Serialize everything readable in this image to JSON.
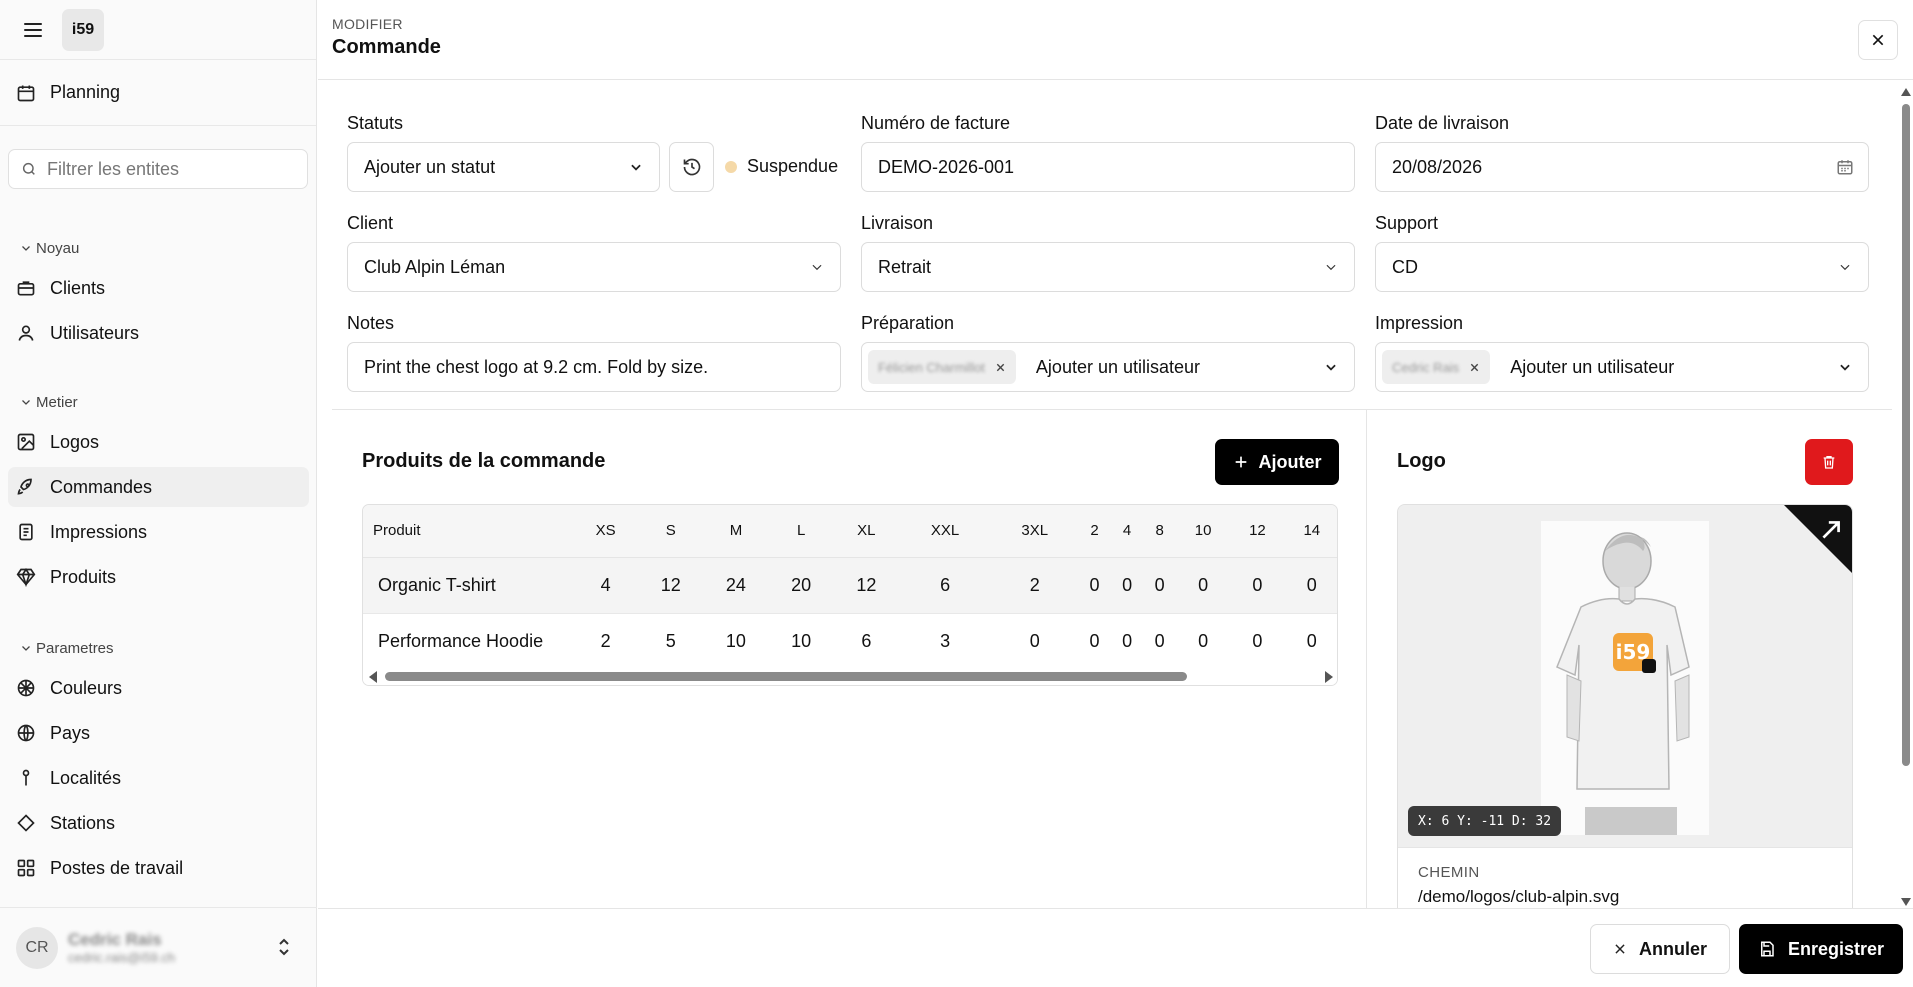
{
  "app": {
    "brand": "i59"
  },
  "sidebar": {
    "planning": "Planning",
    "filter_placeholder": "Filtrer les entites",
    "groups": [
      {
        "label": "Noyau",
        "items": [
          "Clients",
          "Utilisateurs"
        ]
      },
      {
        "label": "Metier",
        "items": [
          "Logos",
          "Commandes",
          "Impressions",
          "Produits"
        ]
      },
      {
        "label": "Parametres",
        "items": [
          "Couleurs",
          "Pays",
          "Localités",
          "Stations",
          "Postes de travail"
        ]
      }
    ],
    "active_item": "Commandes",
    "user": {
      "initials": "CR",
      "name": "Cedric Rais",
      "email": "cedric.rais@i59.ch"
    }
  },
  "header": {
    "overline": "MODIFIER",
    "title": "Commande"
  },
  "form": {
    "statuts": {
      "label": "Statuts",
      "placeholder": "Ajouter un statut",
      "status": "Suspendue",
      "status_color": "#f5d9a8"
    },
    "facture": {
      "label": "Numéro de facture",
      "value": "DEMO-2026-001"
    },
    "livraison_date": {
      "label": "Date de livraison",
      "value": "20/08/2026"
    },
    "client": {
      "label": "Client",
      "value": "Club Alpin Léman"
    },
    "livraison": {
      "label": "Livraison",
      "value": "Retrait"
    },
    "support": {
      "label": "Support",
      "value": "CD"
    },
    "notes": {
      "label": "Notes",
      "value": "Print the chest logo at 9.2 cm. Fold by size."
    },
    "preparation": {
      "label": "Préparation",
      "tag": "Félicien Charmillot",
      "placeholder": "Ajouter un utilisateur"
    },
    "impression": {
      "label": "Impression",
      "tag": "Cedric Rais",
      "placeholder": "Ajouter un utilisateur"
    }
  },
  "products": {
    "title": "Produits de la commande",
    "add_label": "Ajouter",
    "columns": [
      "Produit",
      "XS",
      "S",
      "M",
      "L",
      "XL",
      "XXL",
      "3XL",
      "2",
      "4",
      "8",
      "10",
      "12",
      "14"
    ],
    "rows": [
      [
        "Organic T-shirt",
        "4",
        "12",
        "24",
        "20",
        "12",
        "6",
        "2",
        "0",
        "0",
        "0",
        "0",
        "0",
        "0"
      ],
      [
        "Performance Hoodie",
        "2",
        "5",
        "10",
        "10",
        "6",
        "3",
        "0",
        "0",
        "0",
        "0",
        "0",
        "0",
        "0"
      ]
    ]
  },
  "logo": {
    "title": "Logo",
    "coords": "X: 6 Y: -11 D: 32",
    "path_label": "CHEMIN",
    "path_value": "/demo/logos/club-alpin.svg",
    "accent": "#e0191c"
  },
  "footer": {
    "cancel_label": "Annuler",
    "save_label": "Enregistrer"
  }
}
